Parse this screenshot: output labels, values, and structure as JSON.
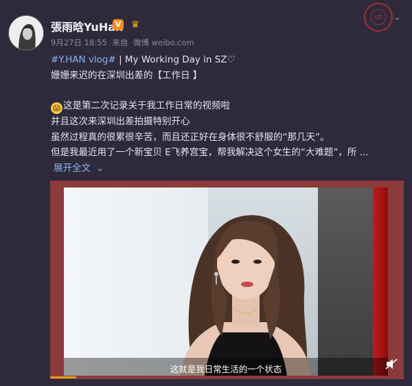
{
  "user": {
    "name": "張雨晗YuHan",
    "verified": "V",
    "time": "9月27日 18:55",
    "from": "来自",
    "source": "微博 weibo.com"
  },
  "post": {
    "line1_tag": "#Y.HAN vlog#",
    "line1_rest": " | My Working Day in SZ♡",
    "line2": "姗姗来迟的在深圳出差的【工作日 】",
    "line3": "这是第二次记录关于我工作日常的视频啦",
    "line4": "并且这次来深圳出差拍摄特别开心",
    "line5": "虽然过程真的很累很辛苦，而且还正好在身体很不舒服的“那几天”。",
    "line6": "但是我最近用了一个新宝贝 E飞养宫宝，帮我解决这个女生的“大难题”，所 ...",
    "expand": "展开全文",
    "expand_arrow": "⌄"
  },
  "video": {
    "subtitle": "这就是我日常生活的一个状态"
  },
  "icons": {
    "more": "chevron-down-icon",
    "emoji": "astonished-face-icon",
    "mute": "volume-mute-icon"
  },
  "colors": {
    "background": "#2e2a3c",
    "link": "#8fb1f0",
    "frame": "#8c3b3b"
  }
}
